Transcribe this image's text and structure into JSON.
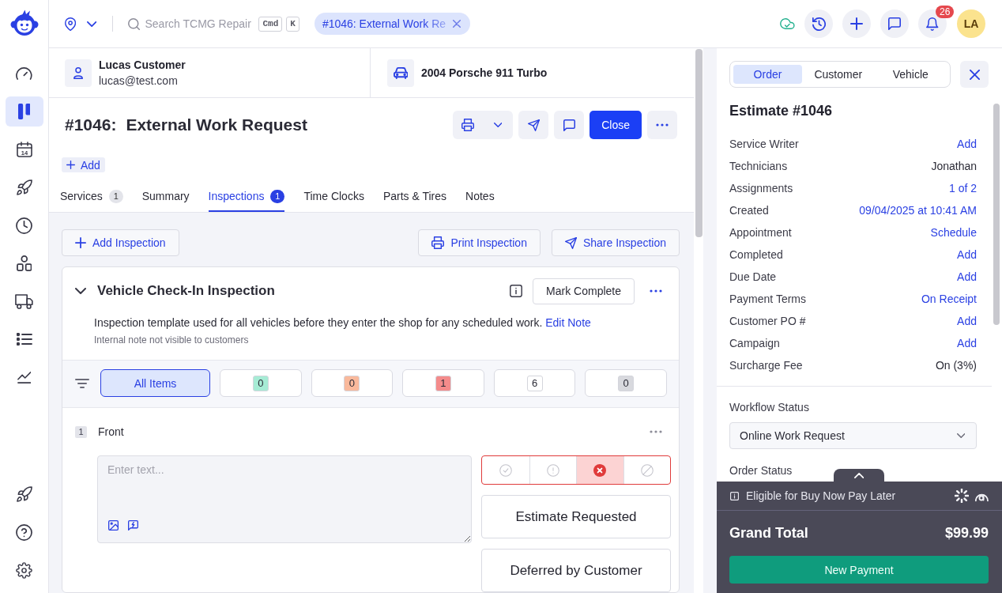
{
  "sidebar": {
    "items": [
      {
        "selected": false
      },
      {
        "selected": true
      },
      {
        "selected": false,
        "day": "14"
      },
      {
        "selected": false
      },
      {
        "selected": false
      },
      {
        "selected": false
      },
      {
        "selected": false
      },
      {
        "selected": false
      },
      {
        "selected": false
      }
    ]
  },
  "top_bar": {
    "search": {
      "placeholder": "Search TCMG Repair",
      "shortcut_keys": [
        "Cmd",
        "K"
      ]
    },
    "open_tab": {
      "label": "#1046: External Work Re"
    },
    "notification_count": "26",
    "avatar_initials": "LA"
  },
  "customer": {
    "name": "Lucas Customer",
    "email": "lucas@test.com"
  },
  "vehicle": {
    "name": "2004 Porsche 911 Turbo"
  },
  "order": {
    "number": "#1046:",
    "title": "External Work Request",
    "close_button": "Close",
    "add_button": "Add"
  },
  "tabs": [
    {
      "label": "Services",
      "count": "1",
      "selected": false
    },
    {
      "label": "Summary",
      "selected": false
    },
    {
      "label": "Inspections",
      "count": "1",
      "selected": true
    },
    {
      "label": "Time Clocks",
      "selected": false
    },
    {
      "label": "Parts & Tires",
      "selected": false
    },
    {
      "label": "Notes",
      "selected": false
    }
  ],
  "inspection_toolbar": {
    "add_button": "Add Inspection",
    "print_button": "Print Inspection",
    "share_button": "Share Inspection"
  },
  "inspection": {
    "title": "Vehicle Check-In Inspection",
    "expanded": true,
    "mark_complete_button": "Mark Complete",
    "note": "Inspection template used for all vehicles before they enter the shop for any scheduled work.",
    "edit_note_link": "Edit Note",
    "note_hint": "Internal note not visible to customers",
    "filters": [
      {
        "kind": "all",
        "label": "All Items",
        "selected": true
      },
      {
        "kind": "count",
        "count": "0",
        "color": "#a6ecd5",
        "selected": false
      },
      {
        "kind": "count",
        "count": "0",
        "color": "#f9b99c",
        "selected": false
      },
      {
        "kind": "count",
        "count": "1",
        "color": "#f48b8b",
        "selected": false
      },
      {
        "kind": "count",
        "count": "6",
        "color": "#ffffff",
        "selected": false
      },
      {
        "kind": "count",
        "count": "0",
        "color": "#d8d9de",
        "selected": false
      }
    ],
    "items": [
      {
        "number": "1",
        "name": "Front",
        "notes_placeholder": "Enter text...",
        "statuses": [
          {
            "kind": "pass",
            "selected": false
          },
          {
            "kind": "attention",
            "selected": false
          },
          {
            "kind": "fail",
            "selected": true
          },
          {
            "kind": "not_applicable",
            "selected": false
          }
        ],
        "recommendations": [
          "Estimate Requested",
          "Deferred by Customer"
        ]
      }
    ]
  },
  "right_panel": {
    "tabs": [
      {
        "label": "Order",
        "selected": true
      },
      {
        "label": "Customer",
        "selected": false
      },
      {
        "label": "Vehicle",
        "selected": false
      }
    ],
    "title": "Estimate #1046",
    "fields": [
      {
        "label": "Service Writer",
        "value": "Add",
        "kind": "link"
      },
      {
        "label": "Technicians",
        "value": "Jonathan",
        "kind": "text"
      },
      {
        "label": "Assignments",
        "value": "1 of 2",
        "kind": "link"
      },
      {
        "label": "Created",
        "value": "09/04/2025 at 10:41 AM",
        "kind": "link"
      },
      {
        "label": "Appointment",
        "value": "Schedule",
        "kind": "link"
      },
      {
        "label": "Completed",
        "value": "Add",
        "kind": "link"
      },
      {
        "label": "Due Date",
        "value": "Add",
        "kind": "link"
      },
      {
        "label": "Payment Terms",
        "value": "On Receipt",
        "kind": "link"
      },
      {
        "label": "Customer PO #",
        "value": "Add",
        "kind": "link"
      },
      {
        "label": "Campaign",
        "value": "Add",
        "kind": "link"
      },
      {
        "label": "Surcharge Fee",
        "value": "On (3%)",
        "kind": "text"
      }
    ],
    "workflow_status": {
      "label": "Workflow Status",
      "value": "Online Work Request"
    },
    "order_status_label": "Order Status",
    "footer": {
      "expanded": false,
      "financing_note": "Eligible for Buy Now Pay Later",
      "total_label": "Grand Total",
      "total": "$99.99",
      "payment_button": "New Payment"
    }
  }
}
